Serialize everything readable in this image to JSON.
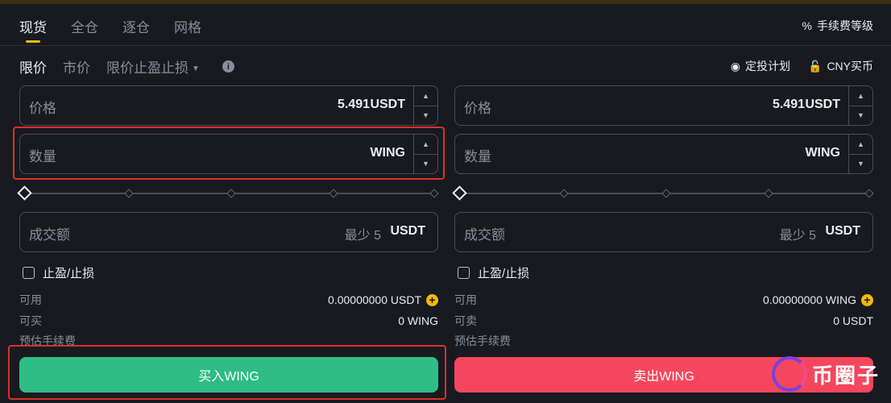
{
  "tabs": [
    "现货",
    "全仓",
    "逐仓",
    "网格"
  ],
  "fee_level": "手续费等级",
  "order_types": {
    "limit": "限价",
    "market": "市价",
    "stop_limit": "限价止盈止损"
  },
  "right_links": {
    "dca": "定投计划",
    "buy_cny": "CNY买币"
  },
  "buy": {
    "price_label": "价格",
    "price_value": "5.491",
    "price_unit": "USDT",
    "qty_label": "数量",
    "qty_unit": "WING",
    "total_label": "成交额",
    "total_min": "最少 5",
    "total_unit": "USDT",
    "tpsl_label": "止盈/止损",
    "available_label": "可用",
    "available_value": "0.00000000 USDT",
    "max_label": "可买",
    "max_value": "0 WING",
    "fee_label": "预估手续费",
    "action_label": "买入WING"
  },
  "sell": {
    "price_label": "价格",
    "price_value": "5.491",
    "price_unit": "USDT",
    "qty_label": "数量",
    "qty_unit": "WING",
    "total_label": "成交额",
    "total_min": "最少 5",
    "total_unit": "USDT",
    "tpsl_label": "止盈/止损",
    "available_label": "可用",
    "available_value": "0.00000000 WING",
    "max_label": "可卖",
    "max_value": "0 USDT",
    "fee_label": "预估手续费",
    "action_label": "卖出WING"
  },
  "watermark": "币圈子",
  "colors": {
    "buy": "#2ebd85",
    "sell": "#f6465d",
    "accent": "#f0b90b",
    "highlight": "#d9302a"
  }
}
